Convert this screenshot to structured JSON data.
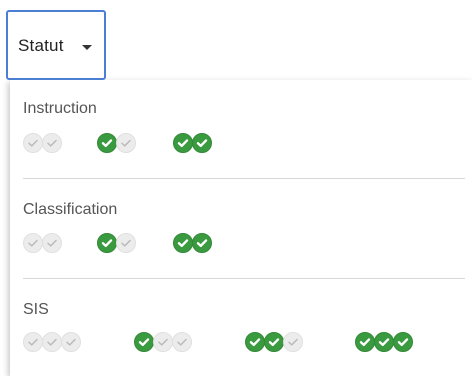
{
  "trigger": {
    "label": "Statut"
  },
  "colors": {
    "accent_border": "#4a7fd4",
    "check_on": "#3a9a3f",
    "check_off": "#ececec"
  },
  "sections": [
    {
      "title": "Instruction",
      "options": [
        {
          "checked": 0,
          "total": 2
        },
        {
          "checked": 1,
          "total": 2
        },
        {
          "checked": 2,
          "total": 2
        }
      ]
    },
    {
      "title": "Classification",
      "options": [
        {
          "checked": 0,
          "total": 2
        },
        {
          "checked": 1,
          "total": 2
        },
        {
          "checked": 2,
          "total": 2
        }
      ]
    },
    {
      "title": "SIS",
      "options": [
        {
          "checked": 0,
          "total": 3
        },
        {
          "checked": 1,
          "total": 3
        },
        {
          "checked": 2,
          "total": 3
        },
        {
          "checked": 3,
          "total": 3
        }
      ]
    }
  ]
}
